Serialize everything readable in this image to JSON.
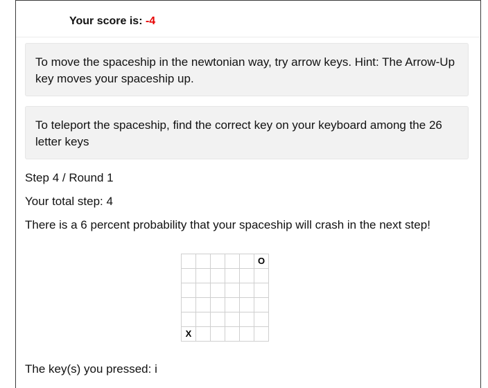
{
  "score": {
    "label": "Your score is:",
    "value": "-4",
    "value_color": "#e60000"
  },
  "hints": [
    "To move the spaceship in the newtonian way, try arrow keys. Hint: The Arrow-Up key moves your spaceship up.",
    "To teleport the spaceship, find the correct key on your keyboard among the 26 letter keys"
  ],
  "status": {
    "step_round": "Step 4 / Round 1",
    "total_step": "Your total step: 4",
    "crash_probability": "There is a 6 percent probability that your spaceship will crash in the next step!"
  },
  "board": {
    "rows": [
      [
        "",
        "",
        "",
        "",
        "",
        "O"
      ],
      [
        "",
        "",
        "",
        "",
        "",
        ""
      ],
      [
        "",
        "",
        "",
        "",
        "",
        ""
      ],
      [
        "",
        "",
        "",
        "",
        "",
        ""
      ],
      [
        "",
        "",
        "",
        "",
        "",
        ""
      ],
      [
        "X",
        "",
        "",
        "",
        "",
        ""
      ]
    ]
  },
  "keys_pressed": "The key(s) you pressed: i"
}
